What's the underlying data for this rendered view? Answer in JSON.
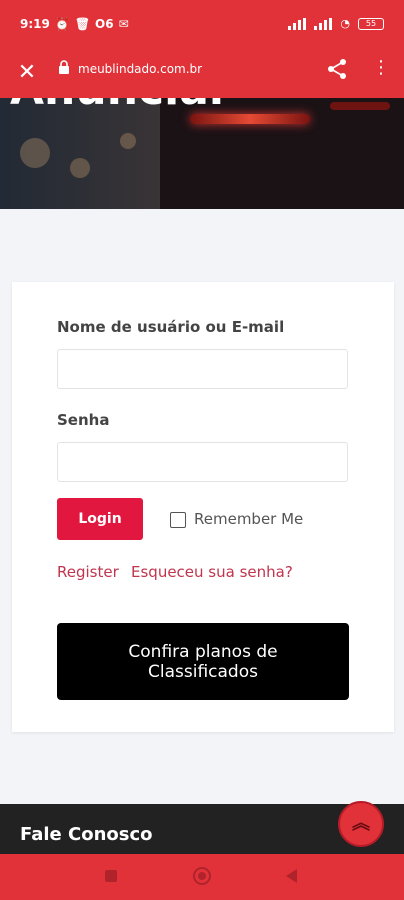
{
  "status": {
    "time": "9:19",
    "extra": "O6",
    "battery": "55"
  },
  "browser": {
    "url": "meublindado.com.br"
  },
  "hero": {
    "title": "Anunciar"
  },
  "login": {
    "username_label": "Nome de usuário ou E-mail",
    "username_value": "",
    "password_label": "Senha",
    "password_value": "",
    "login_button": "Login",
    "remember_label": "Remember Me",
    "remember_checked": false,
    "register_link": "Register",
    "forgot_link": "Esqueceu sua senha?",
    "plans_button_line1": "Confira planos de",
    "plans_button_line2": "Classificados"
  },
  "footer": {
    "title": "Fale Conosco"
  },
  "icons": {
    "close": "close-icon",
    "lock": "lock-icon",
    "share": "share-icon",
    "menu": "more-vert-icon",
    "scroll_top": "chevron-double-up-icon"
  },
  "colors": {
    "brand_red": "#e1323a",
    "login_button": "#e1173f",
    "link": "#c0344d",
    "footer": "#222222"
  }
}
